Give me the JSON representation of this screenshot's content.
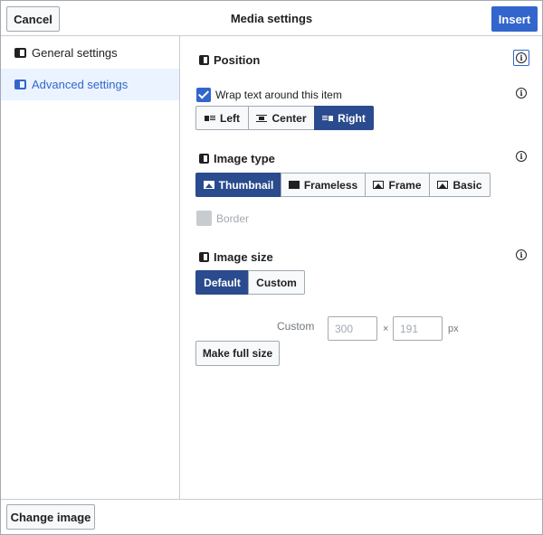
{
  "header": {
    "cancel_label": "Cancel",
    "title": "Media settings",
    "insert_label": "Insert"
  },
  "sidebar": {
    "items": [
      {
        "label": "General settings",
        "active": false
      },
      {
        "label": "Advanced settings",
        "active": true
      }
    ]
  },
  "position": {
    "title": "Position",
    "wrap_label": "Wrap text around this item",
    "wrap_checked": true,
    "options": [
      "Left",
      "Center",
      "Right"
    ],
    "selected": "Right"
  },
  "image_type": {
    "title": "Image type",
    "options": [
      "Thumbnail",
      "Frameless",
      "Frame",
      "Basic"
    ],
    "selected": "Thumbnail",
    "border_label": "Border",
    "border_checked": false
  },
  "image_size": {
    "title": "Image size",
    "options": [
      "Default",
      "Custom"
    ],
    "selected": "Default",
    "custom_label": "Custom",
    "width_placeholder": "300",
    "height_placeholder": "191",
    "times": "×",
    "unit": "px",
    "full_size_label": "Make full size"
  },
  "footer": {
    "change_image_label": "Change image"
  },
  "colors": {
    "accent": "#3366cc",
    "selected": "#2a4b8d",
    "sidebar_active_bg": "#eaf3ff"
  }
}
